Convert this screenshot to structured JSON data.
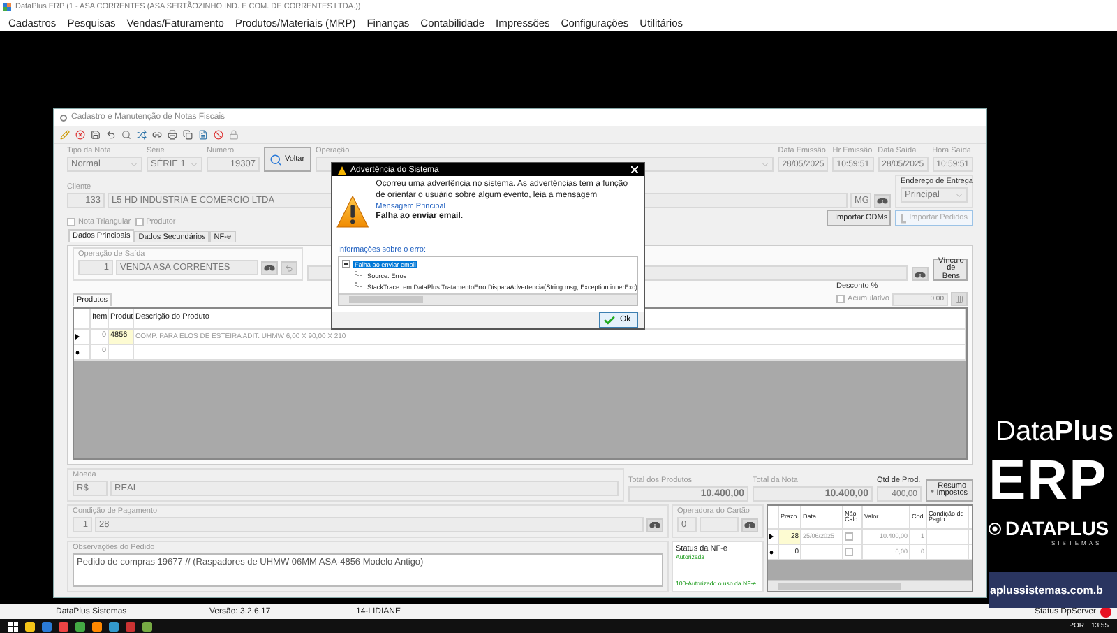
{
  "app_title": "DataPlus ERP (1 - ASA CORRENTES (ASA SERTÃOZINHO IND. E COM. DE CORRENTES LTDA.))",
  "menu": [
    "Cadastros",
    "Pesquisas",
    "Vendas/Faturamento",
    "Produtos/Materiais (MRP)",
    "Finanças",
    "Contabilidade",
    "Impressões",
    "Configurações",
    "Utilitários"
  ],
  "form": {
    "title": "Cadastro e Manutenção de Notas Fiscais",
    "tipo_nota": {
      "label": "Tipo da Nota",
      "value": "Normal"
    },
    "serie": {
      "label": "Série",
      "value": "SÉRIE 1"
    },
    "numero": {
      "label": "Número",
      "value": "19307"
    },
    "voltar_button": "Voltar",
    "operacao_label": "Operação",
    "dates": [
      {
        "label": "Data Emissão",
        "value": "28/05/2025"
      },
      {
        "label": "Hr Emissão",
        "value": "10:59:51"
      },
      {
        "label": "Data Saída",
        "value": "28/05/2025"
      },
      {
        "label": "Hora Saída",
        "value": "10:59:51"
      }
    ],
    "cliente": {
      "label": "Cliente",
      "code": "133",
      "name": "L5 HD INDUSTRIA E COMERCIO LTDA",
      "uf": "MG"
    },
    "endereco": {
      "label": "Endereço de Entrega",
      "value": "Principal"
    },
    "checks": [
      {
        "label": "Nota Triangular",
        "checked": false
      },
      {
        "label": "Produtor",
        "checked": false
      }
    ],
    "import_buttons": [
      {
        "label": "Importar ODMs",
        "disabled": false
      },
      {
        "label": "Importar Pedidos",
        "disabled": true
      }
    ],
    "tabs": [
      {
        "label": "Dados Principais",
        "selected": true
      },
      {
        "label": "Dados Secundários",
        "selected": false
      },
      {
        "label": "NF-e",
        "selected": false
      }
    ],
    "operacao_saida": {
      "label": "Operação de Saída",
      "code": "1",
      "name": "VENDA ASA CORRENTES"
    },
    "vinculo_button": "Vínculo de Bens",
    "sub_tabs": [
      {
        "label": "Produtos",
        "selected": true
      }
    ],
    "desconto": {
      "label": "Desconto %",
      "acumulativo_label": "Acumulativo",
      "acumulativo_checked": false,
      "value": "0,00"
    },
    "products": {
      "columns": [
        "Item",
        "Produt",
        "Descrição do Produto"
      ],
      "rows": [
        {
          "kind": "current",
          "item": "0",
          "produto": "4856",
          "descricao": "COMP. PARA ELOS DE ESTEIRA ADIT. UHMW 6,00 X 90,00 X 210"
        },
        {
          "kind": "new",
          "item": "0"
        }
      ]
    },
    "moeda": {
      "label": "Moeda",
      "symbol": "R$",
      "name": "REAL"
    },
    "totals": [
      {
        "label": "Total dos Produtos",
        "value": "10.400,00"
      },
      {
        "label": "Total da Nota",
        "value": "10.400,00"
      },
      {
        "label": "Qtd de Prod.",
        "value": "400,00"
      }
    ],
    "resumo_button": "Resumo Impostos",
    "condicao": {
      "label": "Condição de Pagamento",
      "code": "1",
      "name": "28"
    },
    "operadora": {
      "label": "Operadora do Cartão",
      "code": "0"
    },
    "observacoes": {
      "label": "Observações do Pedido",
      "text": "Pedido de compras 19677 // (Raspadores de UHMW 06MM ASA-4856 Modelo Antigo)"
    },
    "status_nfe": {
      "label": "Status da NF-e",
      "status": "Autorizada",
      "message": "100-Autorizado o uso da NF-e"
    },
    "installments": {
      "columns": [
        "Prazo",
        "Data",
        "Não Calc.",
        "Valor",
        "Cod.",
        "Condição de Pagto"
      ],
      "rows": [
        {
          "kind": "current",
          "prazo": "28",
          "data": "25/06/2025",
          "nao_calc": false,
          "valor": "10.400,00",
          "cod": "1"
        },
        {
          "kind": "new",
          "prazo": "0",
          "nao_calc": false,
          "valor": "0,00",
          "cod": "0"
        }
      ]
    }
  },
  "dialog": {
    "title": "Advertência do Sistema",
    "intro": "Ocorreu uma advertência no sistema. As advertências tem a função de orientar o usuário sobre algum evento, leia a mensagem",
    "main_label": "Mensagem Principal",
    "main_message": "Falha ao enviar email.",
    "info_label": "Informações sobre o erro:",
    "tree": [
      {
        "label": "Falha ao enviar email",
        "selected": true,
        "expanded": true,
        "children": [
          {
            "label": "Source: Erros",
            "selected": false
          },
          {
            "label": "StackTrace:    em DataPlus.TratamentoErro.DisparaAdvertencia(String msg, Exception innerExc)",
            "selected": false
          }
        ]
      }
    ],
    "ok_button": "Ok"
  },
  "branding": {
    "name_light": "Data",
    "name_bold": "Plus",
    "product": "ERP",
    "company": "DATAPLUS",
    "tagline": "SISTEMAS",
    "site": "aplussistemas.com.b"
  },
  "status_bar": {
    "company": "DataPlus Sistemas",
    "version": "Versão: 3.2.6.17",
    "user": "14-LIDIANE",
    "server_label": "Status DpServer"
  },
  "taskbar": {
    "language": "POR",
    "time": "13:55"
  }
}
